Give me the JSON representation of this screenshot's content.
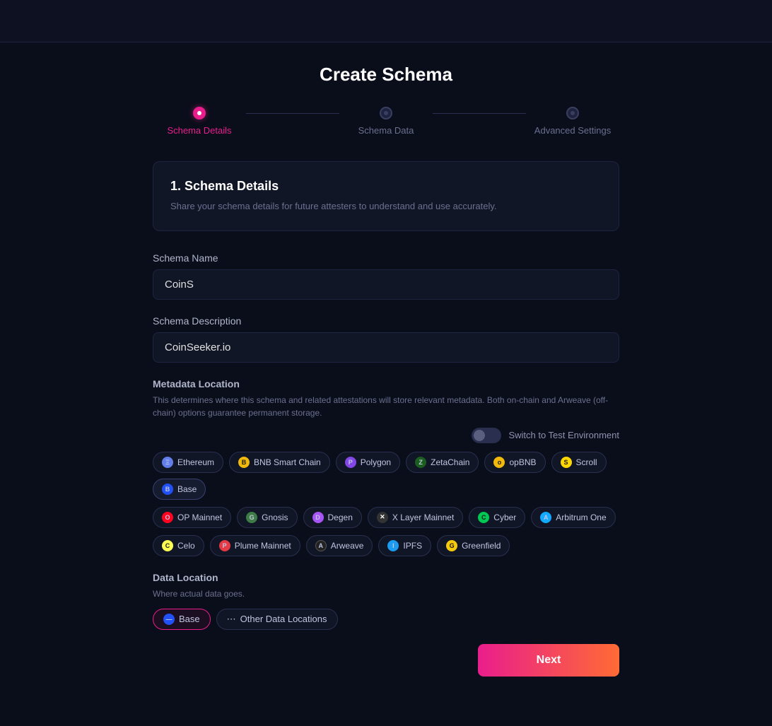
{
  "page": {
    "title": "Create Schema",
    "topbar": {}
  },
  "stepper": {
    "steps": [
      {
        "id": "schema-details",
        "label": "Schema Details",
        "state": "active"
      },
      {
        "id": "schema-data",
        "label": "Schema Data",
        "state": "inactive"
      },
      {
        "id": "advanced-settings",
        "label": "Advanced Settings",
        "state": "inactive"
      }
    ]
  },
  "schema_details_box": {
    "heading": "1. Schema Details",
    "description": "Share your schema details for future attesters to understand and use accurately."
  },
  "form": {
    "schema_name_label": "Schema Name",
    "schema_name_value": "CoinS",
    "schema_description_label": "Schema Description",
    "schema_description_value": "CoinSeeker.io",
    "metadata_location_label": "Metadata Location",
    "metadata_location_desc": "This determines where this schema and related attestations will store relevant metadata. Both on-chain and Arweave (off-chain) options guarantee permanent storage.",
    "switch_label": "Switch to Test Environment"
  },
  "chains": [
    {
      "id": "ethereum",
      "label": "Ethereum",
      "icon_color": "#627eea",
      "icon_text": "Ξ"
    },
    {
      "id": "bnb",
      "label": "BNB Smart Chain",
      "icon_color": "#f0b90b",
      "icon_text": "B"
    },
    {
      "id": "polygon",
      "label": "Polygon",
      "icon_color": "#8247e5",
      "icon_text": "P"
    },
    {
      "id": "zetachain",
      "label": "ZetaChain",
      "icon_color": "#1b7c34",
      "icon_text": "Z"
    },
    {
      "id": "opbnb",
      "label": "opBNB",
      "icon_color": "#f0b90b",
      "icon_text": "o"
    },
    {
      "id": "scroll",
      "label": "Scroll",
      "icon_color": "#ffd700",
      "icon_text": "S"
    },
    {
      "id": "base",
      "label": "Base",
      "icon_color": "#2151f5",
      "icon_text": "B"
    },
    {
      "id": "op-mainnet",
      "label": "OP Mainnet",
      "icon_color": "#ff0420",
      "icon_text": "O"
    },
    {
      "id": "gnosis",
      "label": "Gnosis",
      "icon_color": "#3e7c46",
      "icon_text": "G"
    },
    {
      "id": "degen",
      "label": "Degen",
      "icon_color": "#a855f7",
      "icon_text": "D"
    },
    {
      "id": "xlayer",
      "label": "X Layer Mainnet",
      "icon_color": "#333",
      "icon_text": "✕"
    },
    {
      "id": "cyber",
      "label": "Cyber",
      "icon_color": "#00c853",
      "icon_text": "C"
    },
    {
      "id": "arbitrum",
      "label": "Arbitrum One",
      "icon_color": "#12aaff",
      "icon_text": "A"
    },
    {
      "id": "celo",
      "label": "Celo",
      "icon_color": "#fcff52",
      "icon_text": "C"
    },
    {
      "id": "plume",
      "label": "Plume Mainnet",
      "icon_color": "#e63946",
      "icon_text": "P"
    },
    {
      "id": "arweave",
      "label": "Arweave",
      "icon_color": "#444",
      "icon_text": "A"
    },
    {
      "id": "ipfs",
      "label": "IPFS",
      "icon_color": "#1d9bf0",
      "icon_text": "I"
    },
    {
      "id": "greenfield",
      "label": "Greenfield",
      "icon_color": "#f6c90e",
      "icon_text": "G"
    }
  ],
  "data_location": {
    "label": "Data Location",
    "desc": "Where actual data goes.",
    "options": [
      {
        "id": "base-dl",
        "label": "Base",
        "icon_color": "#2151f5",
        "selected": true
      },
      {
        "id": "other-dl",
        "label": "Other Data Locations",
        "icon": "···",
        "selected": false
      }
    ]
  },
  "footer": {
    "next_label": "Next"
  }
}
